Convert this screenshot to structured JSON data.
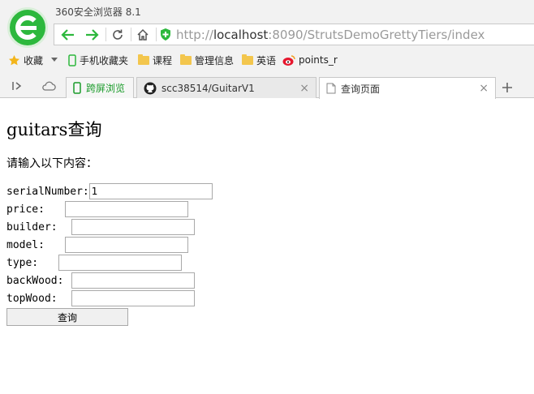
{
  "browser": {
    "title": "360安全浏览器 8.1",
    "url_prefix": "http://",
    "url_host": "localhost",
    "url_rest": ":8090/StrutsDemoGrettyTiers/index"
  },
  "bookmarks": [
    {
      "label": "收藏",
      "icon": "star-icon"
    },
    {
      "label": "手机收藏夹",
      "icon": "phone-icon"
    },
    {
      "label": "课程",
      "icon": "folder-icon"
    },
    {
      "label": "管理信息",
      "icon": "folder-icon"
    },
    {
      "label": "英语",
      "icon": "folder-icon"
    },
    {
      "label": "points_r",
      "icon": "weibo-icon"
    }
  ],
  "tabs": [
    {
      "label": "跨屏浏览",
      "icon": "cross-screen-icon"
    },
    {
      "label": "scc38514/GuitarV1",
      "icon": "github-icon",
      "close": "×"
    },
    {
      "label": "查询页面",
      "icon": "page-icon",
      "close": "×",
      "active": true
    }
  ],
  "page": {
    "heading": "guitars查询",
    "intro": "请输入以下内容：",
    "fields": [
      {
        "label": "serialNumber:",
        "value": "1"
      },
      {
        "label": "price:",
        "value": ""
      },
      {
        "label": "builder:",
        "value": ""
      },
      {
        "label": "model:",
        "value": ""
      },
      {
        "label": "type:",
        "value": ""
      },
      {
        "label": "backWood:",
        "value": ""
      },
      {
        "label": "topWood:",
        "value": ""
      }
    ],
    "submit_label": "查询"
  },
  "colors": {
    "accent_green": "#2db83d",
    "tab_green": "#1a9b2a"
  }
}
